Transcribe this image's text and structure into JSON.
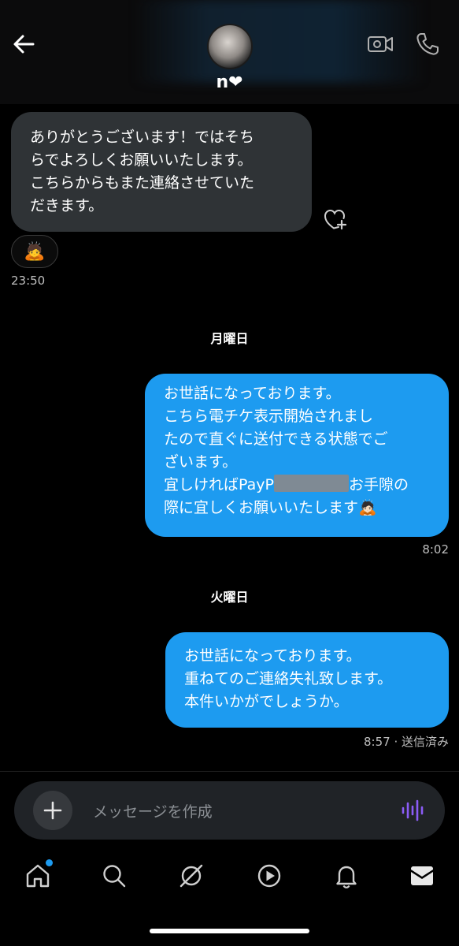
{
  "header": {
    "contact_name": "n❤",
    "icons": [
      "back-arrow-icon",
      "video-call-icon",
      "phone-call-icon"
    ]
  },
  "messages": [
    {
      "direction": "incoming",
      "lines": [
        "ありがとうございます！ではそち",
        "らでよろしくお願いいたします。",
        "こちらからもまた連絡させていた",
        "だきます。"
      ],
      "reaction": "🙇",
      "time": "23:50"
    },
    {
      "day_label": "月曜日"
    },
    {
      "direction": "outgoing",
      "lines": [
        "お世話になっております。",
        "こちら電チケ表示開始されまし",
        "たので直ぐに送付できる状態でご",
        "ざいます。"
      ],
      "line5_before": "宜しければPayP",
      "line5_after": "お手隙の",
      "line6": "際に宜しくお願いいたします",
      "line6_emoji": "🙇🏻",
      "time": "8:02"
    },
    {
      "day_label": "火曜日"
    },
    {
      "direction": "outgoing",
      "lines": [
        "お世話になっております。",
        "重ねてのご連絡失礼致します。",
        "本件いかがでしょうか。"
      ],
      "time": "8:57 · 送信済み"
    }
  ],
  "composer": {
    "placeholder": "メッセージを作成"
  },
  "nav": {
    "items": [
      "home-icon",
      "search-icon",
      "grok-icon",
      "video-icon",
      "notifications-icon",
      "messages-icon"
    ]
  },
  "colors": {
    "accent": "#1d9bf0",
    "incoming_bubble": "#2f3336",
    "voice_icon": "#8b5cf6"
  }
}
